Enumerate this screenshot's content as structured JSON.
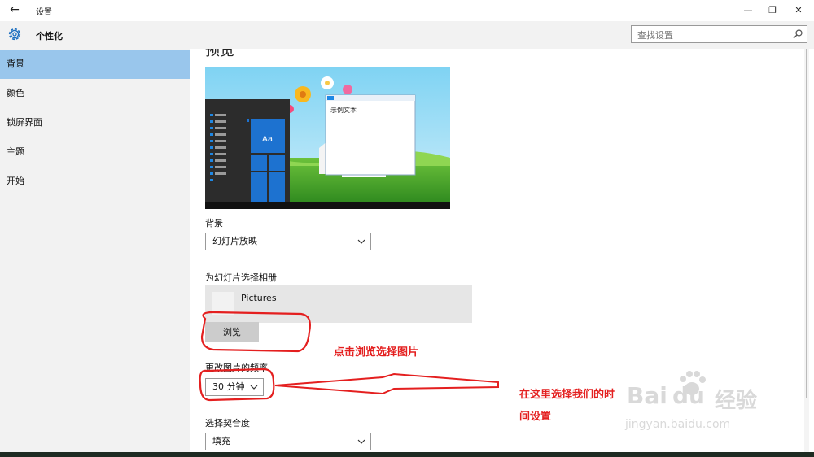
{
  "window": {
    "title": "设置",
    "back_glyph": "←",
    "minimize_glyph": "—",
    "restore_glyph": "❐",
    "close_glyph": "✕"
  },
  "sidebar": {
    "header": "个性化",
    "items": [
      {
        "label": "背景",
        "active": true
      },
      {
        "label": "颜色",
        "active": false
      },
      {
        "label": "锁屏界面",
        "active": false
      },
      {
        "label": "主题",
        "active": false
      },
      {
        "label": "开始",
        "active": false
      }
    ]
  },
  "search": {
    "placeholder": "查找设置"
  },
  "main": {
    "preview_heading": "预览",
    "preview": {
      "sample_text": "示例文本",
      "tile_label": "Aa"
    },
    "background": {
      "label": "背景",
      "value": "幻灯片放映"
    },
    "album": {
      "label": "为幻灯片选择相册",
      "name": "Pictures",
      "browse_label": "浏览"
    },
    "frequency": {
      "label": "更改图片的频率",
      "value": "30 分钟"
    },
    "fit": {
      "label": "选择契合度",
      "value": "填充"
    }
  },
  "annotations": {
    "browse_note": "点击浏览选择图片",
    "time_note_line1": "在这里选择我们的时",
    "time_note_line2": "间设置"
  },
  "watermark": {
    "brand": "Bai",
    "brand2": "du",
    "cn": "经验",
    "url": "jingyan.baidu.com"
  },
  "colors": {
    "accent": "#0078d7",
    "selection": "#99c6ec",
    "annotation": "#e41f1f"
  }
}
